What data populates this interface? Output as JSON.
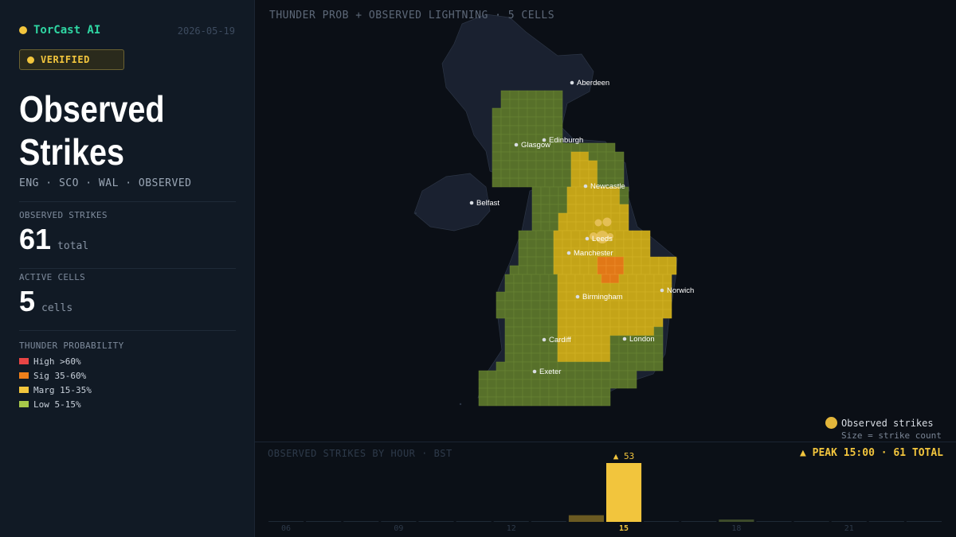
{
  "brand": {
    "name": "TorCast AI",
    "date": "2026-05-19"
  },
  "badge": "VERIFIED",
  "title": {
    "line1": "Observed",
    "line2": "Strikes"
  },
  "subtitle": "ENG · SCO · WAL · OBSERVED",
  "stats": {
    "strikes_label": "OBSERVED STRIKES",
    "strikes_value": "61",
    "strikes_unit": "total",
    "cells_label": "ACTIVE CELLS",
    "cells_value": "5",
    "cells_unit": "cells"
  },
  "legend": {
    "title": "THUNDER PROBABILITY",
    "items": [
      {
        "label": "High >60%",
        "color": "#e84545"
      },
      {
        "label": "Sig 35-60%",
        "color": "#ef7f1a"
      },
      {
        "label": "Marg 15-35%",
        "color": "#f2c53d"
      },
      {
        "label": "Low 5-15%",
        "color": "#a8c94a"
      }
    ]
  },
  "map": {
    "title": "THUNDER PROB + OBSERVED LIGHTNING · 5 CELLS",
    "cities": [
      "Aberdeen",
      "Edinburgh",
      "Glasgow",
      "Newcastle",
      "Belfast",
      "Leeds",
      "Manchester",
      "Norwich",
      "Birmingham",
      "Cardiff",
      "London",
      "Exeter"
    ],
    "legend_title": "Observed strikes",
    "legend_note": "Size = strike count"
  },
  "chart": {
    "title": "OBSERVED STRIKES BY HOUR · BST",
    "peak": "▲ PEAK 15:00  ·  61 TOTAL",
    "peak_label": "▲ 53"
  },
  "chart_data": {
    "type": "bar",
    "categories": [
      "06",
      "07",
      "08",
      "09",
      "10",
      "11",
      "12",
      "13",
      "14",
      "15",
      "16",
      "17",
      "18",
      "19",
      "20",
      "21",
      "22",
      "23"
    ],
    "values": [
      0,
      0,
      0,
      0,
      0,
      0,
      0,
      0,
      6,
      53,
      0,
      0,
      2,
      0,
      0,
      0,
      0,
      0
    ],
    "tick_labels": [
      "06",
      "09",
      "12",
      "15",
      "18",
      "21"
    ],
    "peak_index": 9
  }
}
